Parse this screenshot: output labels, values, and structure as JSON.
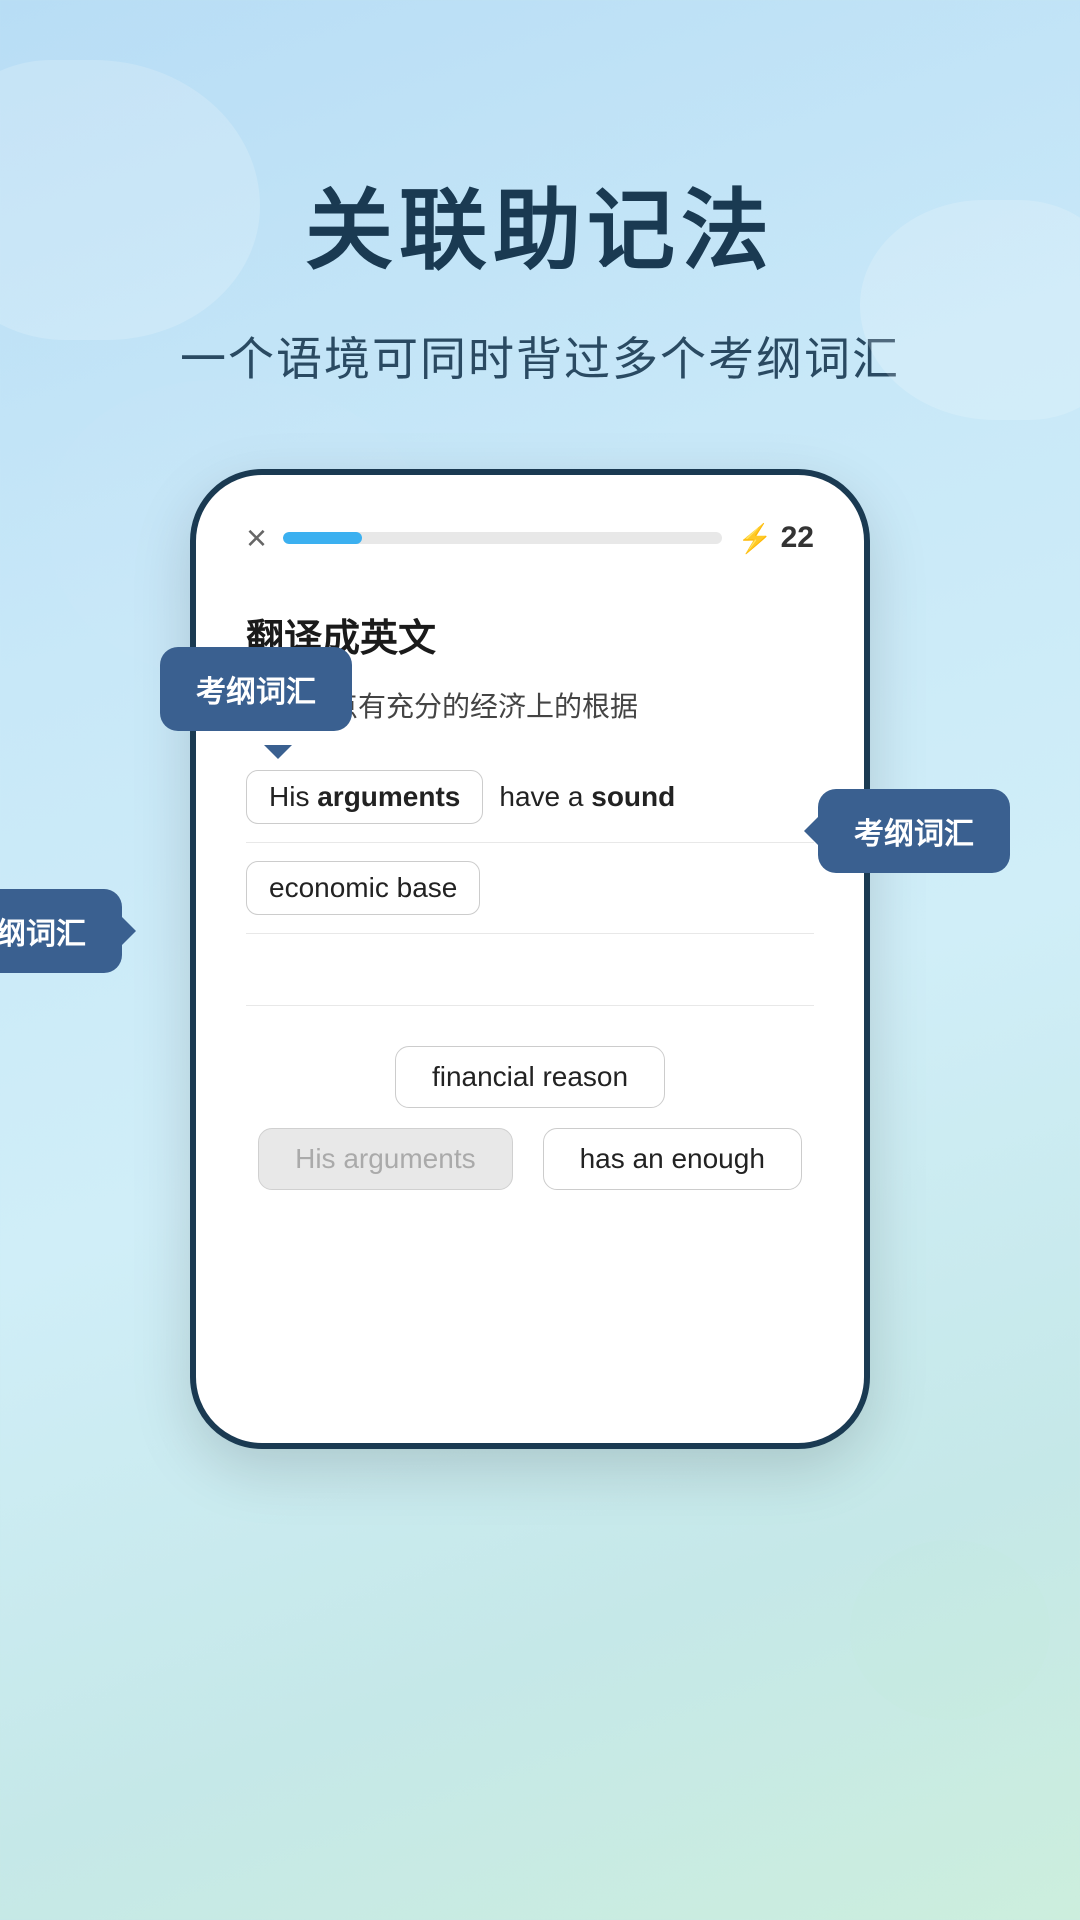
{
  "page": {
    "title": "关联助记法",
    "subtitle": "一个语境可同时背过多个考纲词汇"
  },
  "phone": {
    "close_icon": "×",
    "score": "22",
    "lightning_symbol": "⚡",
    "question_label": "翻译成英文",
    "chinese_sentence": "他的论点有充分的经济上的根据",
    "progress_percent": 18
  },
  "answer_area": {
    "row1_chip": "His arguments",
    "row1_text_prefix": "",
    "row1_text": "have a ",
    "row1_bold": "sound",
    "row2_chip_bold": "economic",
    "row2_chip_text": " base",
    "row3_empty": true
  },
  "bottom_chips": [
    {
      "id": "financial_reason",
      "label": "financial reason",
      "disabled": false
    },
    {
      "id": "his_arguments",
      "label": "His arguments",
      "disabled": true
    },
    {
      "id": "has_an_enough",
      "label": "has an enough",
      "disabled": false
    }
  ],
  "tooltips": [
    {
      "id": "tooltip-1",
      "label": "考纲词汇"
    },
    {
      "id": "tooltip-2",
      "label": "考纲词汇"
    },
    {
      "id": "tooltip-3",
      "label": "考纲词汇"
    }
  ]
}
